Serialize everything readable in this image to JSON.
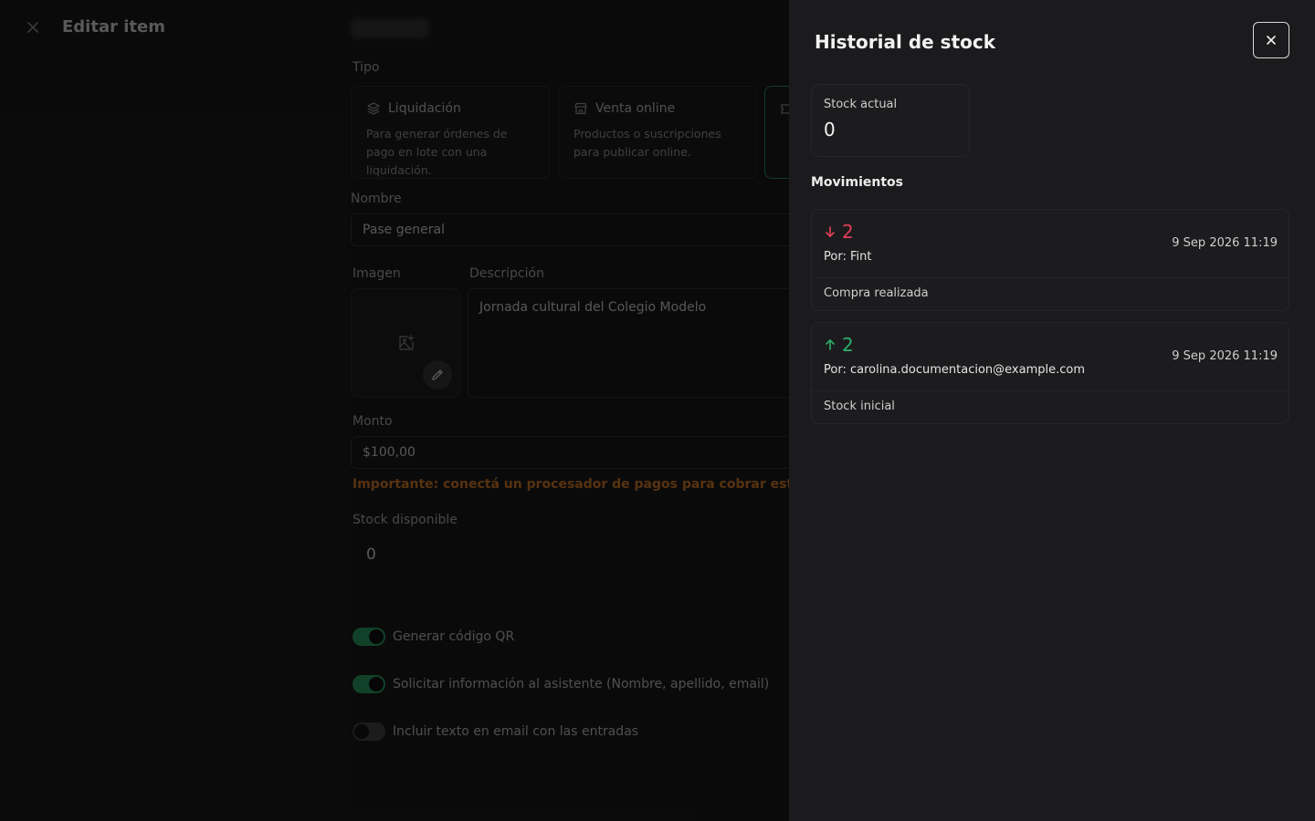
{
  "editor": {
    "title": "Editar item",
    "type_label": "Tipo",
    "types": [
      {
        "name": "Liquidación",
        "desc": "Para generar órdenes de pago en lote con una liquidación.",
        "icon": "layers-icon"
      },
      {
        "name": "Venta online",
        "desc": "Productos o suscripciones para publicar online.",
        "icon": "store-icon"
      },
      {
        "name": "",
        "desc": "",
        "icon": "ticket-icon"
      }
    ],
    "name_label": "Nombre",
    "name_value": "Pase general",
    "image_label": "Imagen",
    "description_label": "Descripción",
    "description_value": "Jornada cultural del Colegio Modelo",
    "amount_label": "Monto",
    "amount_value": "$100,00",
    "warning_text": "Importante: conectá un procesador de pagos para cobrar esta entrada",
    "stock_label": "Stock disponible",
    "stock_value": "0",
    "toggles": [
      {
        "label": "Generar código QR",
        "on": true
      },
      {
        "label": "Solicitar información al asistente (Nombre, apellido, email)",
        "on": true
      },
      {
        "label": "Incluir texto en email con las entradas",
        "on": false
      }
    ]
  },
  "drawer": {
    "title": "Historial de stock",
    "stock_label": "Stock actual",
    "stock_value": "0",
    "movements_title": "Movimientos",
    "movements": [
      {
        "direction": "down",
        "qty": "2",
        "by": "Por: Fint",
        "date": "9 Sep 2026 11:19",
        "note": "Compra realizada"
      },
      {
        "direction": "up",
        "qty": "2",
        "by": "Por: carolina.documentacion@example.com",
        "date": "9 Sep 2026 11:19",
        "note": "Stock inicial"
      }
    ]
  },
  "colors": {
    "accent_green": "#2fae6c",
    "down_red": "#e23f5a",
    "warning_orange": "#e4842a"
  }
}
